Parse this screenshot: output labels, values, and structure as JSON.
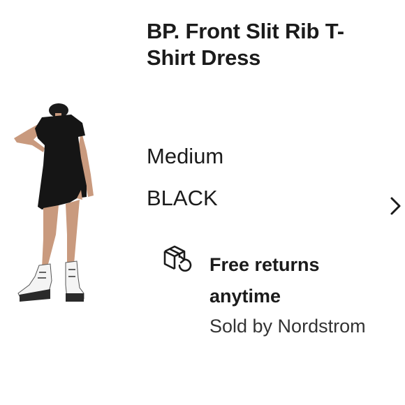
{
  "product": {
    "title": "BP. Front Slit Rib T-Shirt Dress",
    "size": "Medium",
    "color": "BLACK"
  },
  "returns": {
    "label": "Free returns anytime",
    "icon": "box-return-icon"
  },
  "seller": {
    "sold_by": "Sold by Nordstrom"
  },
  "colors": {
    "text": "#1b1b1b",
    "secondary_text": "#333333",
    "dress": "#151515",
    "boots": "#f4f4f4"
  }
}
